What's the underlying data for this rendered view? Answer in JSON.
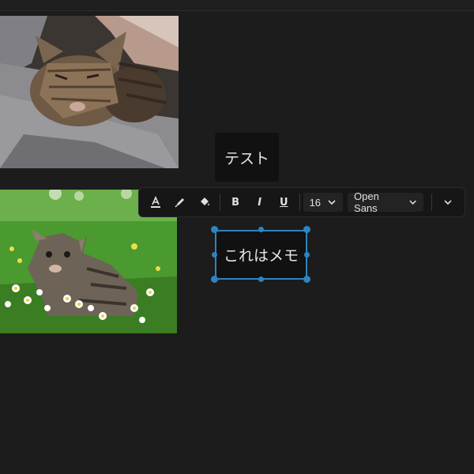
{
  "canvas": {
    "background": "#1c1c1c",
    "accent": "#2d84c0"
  },
  "images": [
    {
      "name": "sleeping-tabby-cat-photo",
      "subject": "sleeping tabby cat on grey blanket"
    },
    {
      "name": "kitten-in-daisies-photo",
      "subject": "tabby kitten in grass with daisies"
    }
  ],
  "notes": {
    "test": "テスト",
    "memo": "これはメモ"
  },
  "toolbar": {
    "text_color_icon": "text-color-icon",
    "highlight_icon": "highlighter-icon",
    "fill_icon": "paint-bucket-icon",
    "bold_label": "B",
    "italic_label": "I",
    "underline_label": "U",
    "font_size": "16",
    "font_family": "Open Sans",
    "more_icon": "chevron-down-icon"
  }
}
